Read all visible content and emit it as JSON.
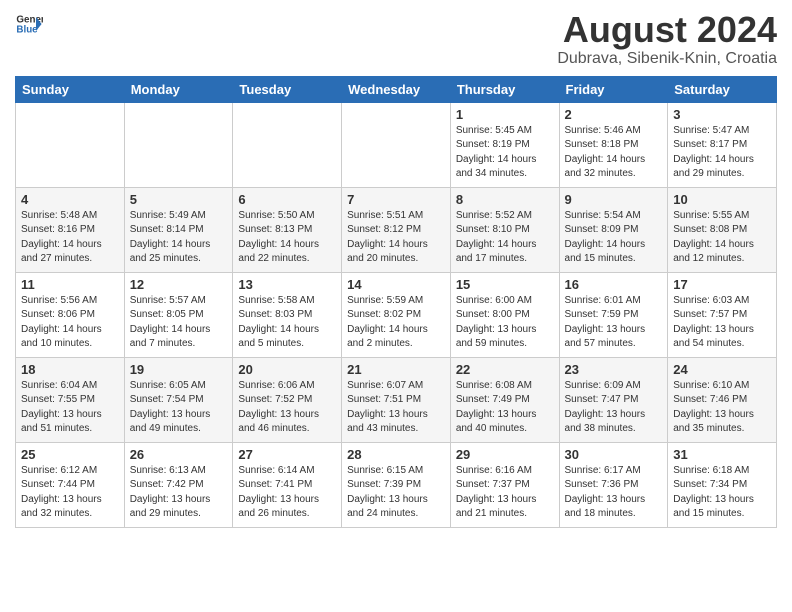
{
  "header": {
    "logo_general": "General",
    "logo_blue": "Blue",
    "month_year": "August 2024",
    "location": "Dubrava, Sibenik-Knin, Croatia"
  },
  "weekdays": [
    "Sunday",
    "Monday",
    "Tuesday",
    "Wednesday",
    "Thursday",
    "Friday",
    "Saturday"
  ],
  "weeks": [
    [
      {
        "day": "",
        "info": ""
      },
      {
        "day": "",
        "info": ""
      },
      {
        "day": "",
        "info": ""
      },
      {
        "day": "",
        "info": ""
      },
      {
        "day": "1",
        "info": "Sunrise: 5:45 AM\nSunset: 8:19 PM\nDaylight: 14 hours\nand 34 minutes."
      },
      {
        "day": "2",
        "info": "Sunrise: 5:46 AM\nSunset: 8:18 PM\nDaylight: 14 hours\nand 32 minutes."
      },
      {
        "day": "3",
        "info": "Sunrise: 5:47 AM\nSunset: 8:17 PM\nDaylight: 14 hours\nand 29 minutes."
      }
    ],
    [
      {
        "day": "4",
        "info": "Sunrise: 5:48 AM\nSunset: 8:16 PM\nDaylight: 14 hours\nand 27 minutes."
      },
      {
        "day": "5",
        "info": "Sunrise: 5:49 AM\nSunset: 8:14 PM\nDaylight: 14 hours\nand 25 minutes."
      },
      {
        "day": "6",
        "info": "Sunrise: 5:50 AM\nSunset: 8:13 PM\nDaylight: 14 hours\nand 22 minutes."
      },
      {
        "day": "7",
        "info": "Sunrise: 5:51 AM\nSunset: 8:12 PM\nDaylight: 14 hours\nand 20 minutes."
      },
      {
        "day": "8",
        "info": "Sunrise: 5:52 AM\nSunset: 8:10 PM\nDaylight: 14 hours\nand 17 minutes."
      },
      {
        "day": "9",
        "info": "Sunrise: 5:54 AM\nSunset: 8:09 PM\nDaylight: 14 hours\nand 15 minutes."
      },
      {
        "day": "10",
        "info": "Sunrise: 5:55 AM\nSunset: 8:08 PM\nDaylight: 14 hours\nand 12 minutes."
      }
    ],
    [
      {
        "day": "11",
        "info": "Sunrise: 5:56 AM\nSunset: 8:06 PM\nDaylight: 14 hours\nand 10 minutes."
      },
      {
        "day": "12",
        "info": "Sunrise: 5:57 AM\nSunset: 8:05 PM\nDaylight: 14 hours\nand 7 minutes."
      },
      {
        "day": "13",
        "info": "Sunrise: 5:58 AM\nSunset: 8:03 PM\nDaylight: 14 hours\nand 5 minutes."
      },
      {
        "day": "14",
        "info": "Sunrise: 5:59 AM\nSunset: 8:02 PM\nDaylight: 14 hours\nand 2 minutes."
      },
      {
        "day": "15",
        "info": "Sunrise: 6:00 AM\nSunset: 8:00 PM\nDaylight: 13 hours\nand 59 minutes."
      },
      {
        "day": "16",
        "info": "Sunrise: 6:01 AM\nSunset: 7:59 PM\nDaylight: 13 hours\nand 57 minutes."
      },
      {
        "day": "17",
        "info": "Sunrise: 6:03 AM\nSunset: 7:57 PM\nDaylight: 13 hours\nand 54 minutes."
      }
    ],
    [
      {
        "day": "18",
        "info": "Sunrise: 6:04 AM\nSunset: 7:55 PM\nDaylight: 13 hours\nand 51 minutes."
      },
      {
        "day": "19",
        "info": "Sunrise: 6:05 AM\nSunset: 7:54 PM\nDaylight: 13 hours\nand 49 minutes."
      },
      {
        "day": "20",
        "info": "Sunrise: 6:06 AM\nSunset: 7:52 PM\nDaylight: 13 hours\nand 46 minutes."
      },
      {
        "day": "21",
        "info": "Sunrise: 6:07 AM\nSunset: 7:51 PM\nDaylight: 13 hours\nand 43 minutes."
      },
      {
        "day": "22",
        "info": "Sunrise: 6:08 AM\nSunset: 7:49 PM\nDaylight: 13 hours\nand 40 minutes."
      },
      {
        "day": "23",
        "info": "Sunrise: 6:09 AM\nSunset: 7:47 PM\nDaylight: 13 hours\nand 38 minutes."
      },
      {
        "day": "24",
        "info": "Sunrise: 6:10 AM\nSunset: 7:46 PM\nDaylight: 13 hours\nand 35 minutes."
      }
    ],
    [
      {
        "day": "25",
        "info": "Sunrise: 6:12 AM\nSunset: 7:44 PM\nDaylight: 13 hours\nand 32 minutes."
      },
      {
        "day": "26",
        "info": "Sunrise: 6:13 AM\nSunset: 7:42 PM\nDaylight: 13 hours\nand 29 minutes."
      },
      {
        "day": "27",
        "info": "Sunrise: 6:14 AM\nSunset: 7:41 PM\nDaylight: 13 hours\nand 26 minutes."
      },
      {
        "day": "28",
        "info": "Sunrise: 6:15 AM\nSunset: 7:39 PM\nDaylight: 13 hours\nand 24 minutes."
      },
      {
        "day": "29",
        "info": "Sunrise: 6:16 AM\nSunset: 7:37 PM\nDaylight: 13 hours\nand 21 minutes."
      },
      {
        "day": "30",
        "info": "Sunrise: 6:17 AM\nSunset: 7:36 PM\nDaylight: 13 hours\nand 18 minutes."
      },
      {
        "day": "31",
        "info": "Sunrise: 6:18 AM\nSunset: 7:34 PM\nDaylight: 13 hours\nand 15 minutes."
      }
    ]
  ]
}
